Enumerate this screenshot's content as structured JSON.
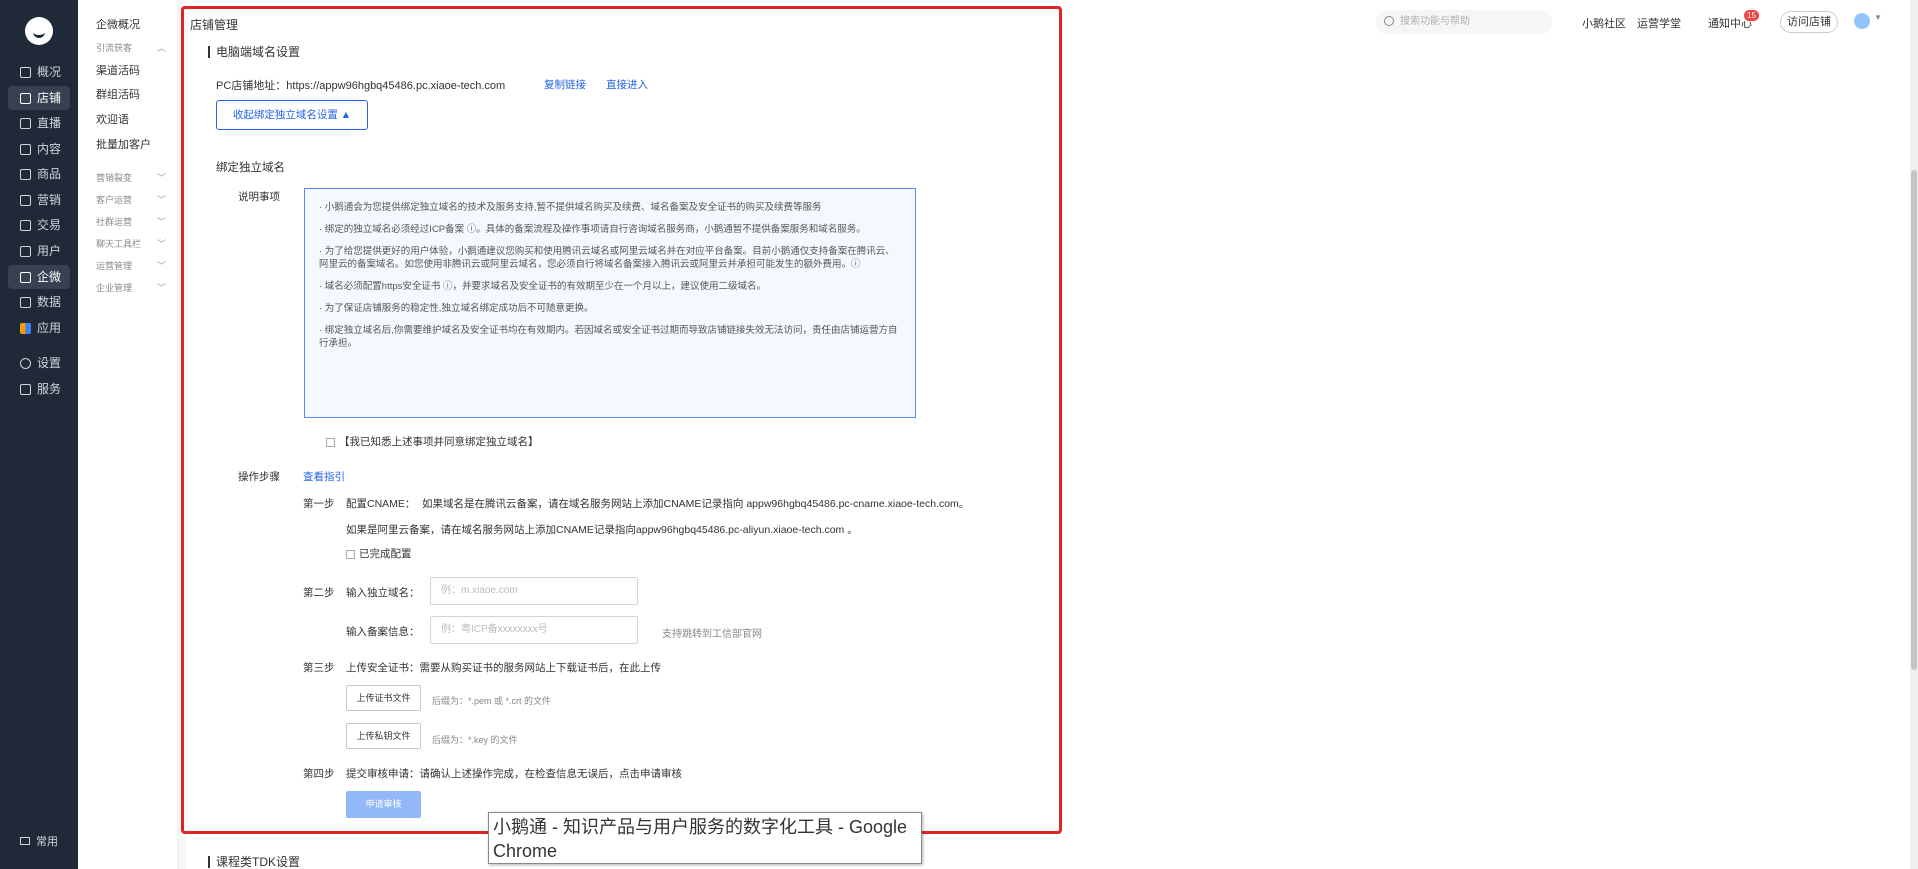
{
  "nav": {
    "items": [
      {
        "label": "概况",
        "icon": "clock-icon"
      },
      {
        "label": "店铺",
        "icon": "store-icon"
      },
      {
        "label": "直播",
        "icon": "live-icon"
      },
      {
        "label": "内容",
        "icon": "document-icon"
      },
      {
        "label": "商品",
        "icon": "box-icon"
      },
      {
        "label": "营销",
        "icon": "megaphone-icon"
      },
      {
        "label": "交易",
        "icon": "trade-icon"
      },
      {
        "label": "用户",
        "icon": "user-icon"
      },
      {
        "label": "企微",
        "icon": "wechat-work-icon"
      },
      {
        "label": "数据",
        "icon": "chart-icon"
      },
      {
        "label": "应用",
        "icon": "apps-icon"
      },
      {
        "label": "设置",
        "icon": "gear-icon"
      },
      {
        "label": "服务",
        "icon": "service-icon"
      }
    ],
    "bottom_label": "常用"
  },
  "subnav": {
    "top_item": "企微概况",
    "group_1": "引流获客",
    "items": [
      "渠道活码",
      "群组活码",
      "欢迎语",
      "批量加客户"
    ],
    "groups": [
      "营销裂变",
      "客户运营",
      "社群运营",
      "聊天工具栏",
      "运营管理",
      "企业管理"
    ]
  },
  "topbar": {
    "search_placeholder": "搜索功能与帮助",
    "links": [
      "小鹅社区",
      "运营学堂",
      "通知中心"
    ],
    "notify_count": "15",
    "visit_label": "访问店铺"
  },
  "page": {
    "title": "店铺管理",
    "section": "电脑端域名设置",
    "pc_address_label": "PC店铺地址：",
    "pc_address": "https://appw96hgbq45486.pc.xiaoe-tech.com",
    "copy_link": "复制链接",
    "enter_link": "直接进入",
    "collapse_btn": "收起绑定独立域名设置 ▲",
    "bind_title": "绑定独立域名",
    "notice_label": "说明事项",
    "notices": [
      "· 小鹅通会为您提供绑定独立域名的技术及服务支持,暂不提供域名购买及续费、域名备案及安全证书的购买及续费等服务",
      "· 绑定的独立域名必须经过ICP备案 ⓘ。具体的备案流程及操作事项请自行咨询域名服务商，小鹅通暂不提供备案服务和域名服务。",
      "· 为了给您提供更好的用户体验，小鹅通建议您购买和使用腾讯云域名或阿里云域名并在对应平台备案。目前小鹅通仅支持备案在腾讯云、阿里云的备案域名。如您使用非腾讯云或阿里云域名，您必须自行将域名备案接入腾讯云或阿里云并承担可能发生的额外费用。ⓘ",
      "· 域名必须配置https安全证书 ⓘ，并要求域名及安全证书的有效期至少在一个月以上，建议使用二级域名。",
      "· 为了保证店铺服务的稳定性,独立域名绑定成功后不可随意更换。",
      "· 绑定独立域名后,你需要维护域名及安全证书均在有效期内。若因域名或安全证书过期而导致店铺链接失效无法访问，责任由店铺运营方自行承担。"
    ],
    "agree_label": "【我已知悉上述事项并同意绑定独立域名】",
    "steps_label": "操作步骤",
    "view_guide": "查看指引",
    "step1_no": "第一步",
    "step1_title": "配置CNAME：",
    "step1_line1": "如果域名是在腾讯云备案，请在域名服务网站上添加CNAME记录指向 appw96hgbq45486.pc-cname.xiaoe-tech.com。",
    "step1_line2": "如果是阿里云备案，请在域名服务网站上添加CNAME记录指向appw96hgbq45486.pc-aliyun.xiaoe-tech.com 。",
    "step1_done": "已完成配置",
    "step2_no": "第二步",
    "step2_domain_label": "输入独立域名：",
    "step2_domain_placeholder": "例：m.xiaoe.com",
    "step2_icp_label": "输入备案信息：",
    "step2_icp_placeholder": "例：粤ICP备xxxxxxxx号",
    "step2_icp_hint": "支持跳转到工信部官网",
    "step3_no": "第三步",
    "step3_title": "上传安全证书：需要从购买证书的服务网站上下载证书后，在此上传",
    "upload_cert": "上传证书文件",
    "upload_cert_hint": "后缀为：*.pem 或 *.crt 的文件",
    "upload_key": "上传私钥文件",
    "upload_key_hint": "后缀为：*.key 的文件",
    "step4_no": "第四步",
    "step4_title": "提交审核申请：请确认上述操作完成，在检查信息无误后，点击申请审核",
    "submit": "申请审核",
    "next_section": "课程类TDK设置"
  },
  "tooltip": {
    "text": "小鹅通 - 知识产品与用户服务的数字化工具 - Google Chrome"
  },
  "colors": {
    "accent": "#2563eb",
    "nav_bg": "#1f2937",
    "highlight_frame": "#e02424"
  }
}
